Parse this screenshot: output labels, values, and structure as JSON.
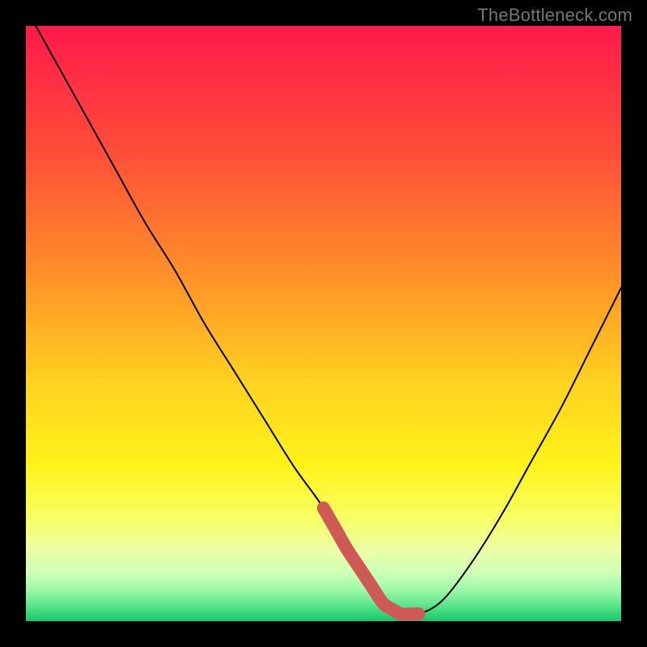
{
  "attribution": "TheBottleneck.com",
  "chart_data": {
    "type": "line",
    "title": "",
    "xlabel": "",
    "ylabel": "",
    "xlim": [
      0,
      100
    ],
    "ylim": [
      0,
      100
    ],
    "gradient_stops": [
      {
        "offset": 0.0,
        "color": "#ff1a4b"
      },
      {
        "offset": 0.2,
        "color": "#ff4a3a"
      },
      {
        "offset": 0.4,
        "color": "#ff8a2a"
      },
      {
        "offset": 0.6,
        "color": "#ffd21f"
      },
      {
        "offset": 0.74,
        "color": "#fff31a"
      },
      {
        "offset": 0.83,
        "color": "#f6ff66"
      },
      {
        "offset": 0.88,
        "color": "#ecffa6"
      },
      {
        "offset": 0.92,
        "color": "#ccffb8"
      },
      {
        "offset": 0.95,
        "color": "#97f7a6"
      },
      {
        "offset": 0.975,
        "color": "#57e38a"
      },
      {
        "offset": 1.0,
        "color": "#15c96b"
      }
    ],
    "x": [
      0,
      5,
      10,
      15,
      20,
      25,
      30,
      35,
      40,
      45,
      50,
      54,
      58,
      60,
      63,
      66,
      70,
      75,
      80,
      85,
      90,
      95,
      100
    ],
    "series": [
      {
        "name": "bottleneck-curve",
        "values": [
          103,
          94,
          85,
          76,
          67,
          59,
          50,
          42,
          34,
          26,
          19,
          12,
          6,
          3,
          1.2,
          1.2,
          3.5,
          10,
          18,
          27,
          36,
          46,
          56
        ]
      }
    ],
    "annotations": [
      {
        "name": "highlight-segment",
        "type": "path",
        "color": "#cf5a55",
        "width": 2.2,
        "x": [
          50,
          52,
          54,
          56,
          58,
          60,
          61.5,
          63,
          64.5,
          66
        ],
        "y": [
          19,
          15.5,
          12,
          9,
          6,
          3,
          2,
          1.2,
          1.2,
          1.2
        ]
      },
      {
        "name": "highlight-dot",
        "type": "dot",
        "color": "#cf5a55",
        "radius": 1.0,
        "x": 50,
        "y": 19
      }
    ]
  }
}
